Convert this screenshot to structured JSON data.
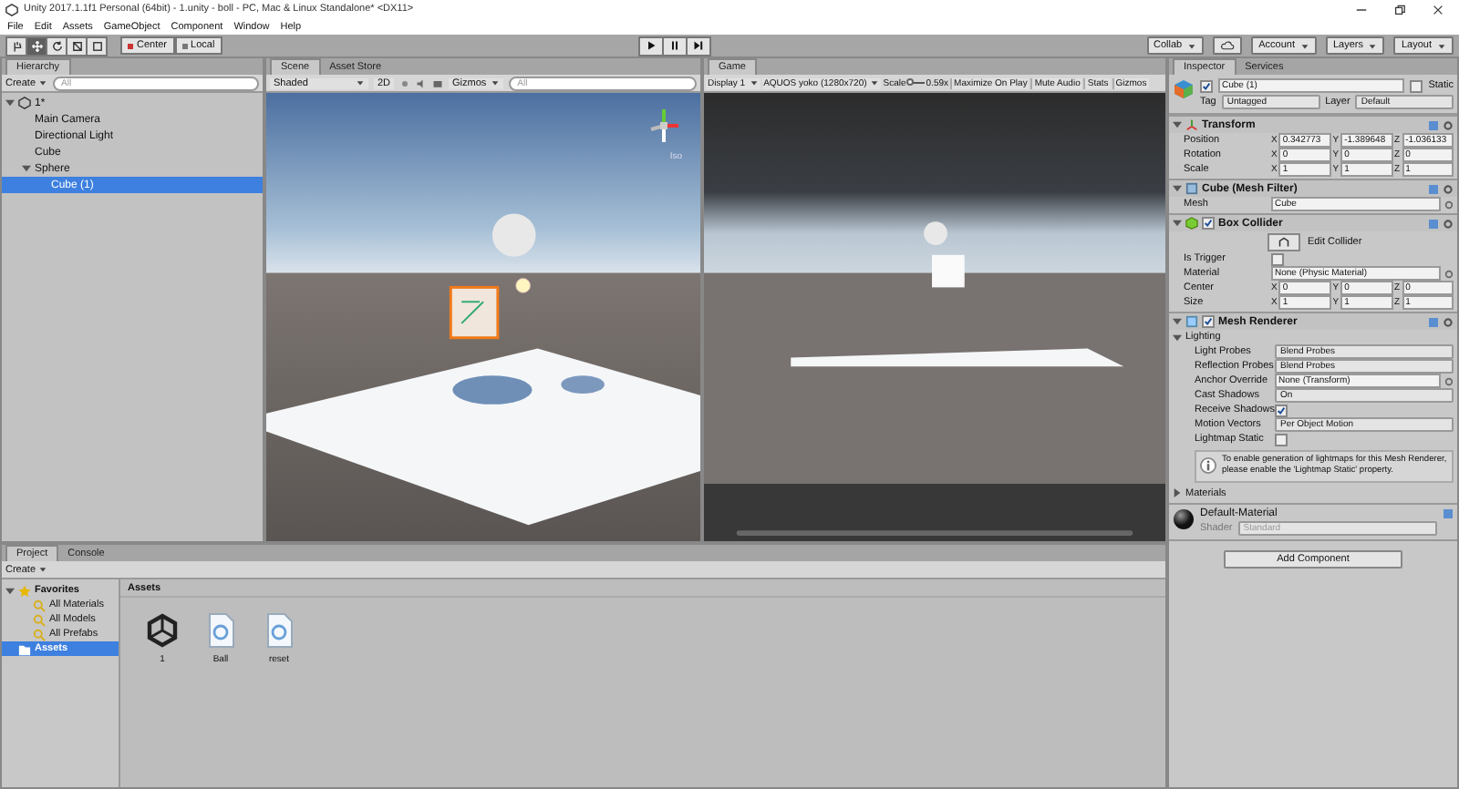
{
  "window": {
    "title": "Unity 2017.1.1f1 Personal (64bit) - 1.unity - boll - PC, Mac & Linux Standalone* <DX11>"
  },
  "menu": [
    "File",
    "Edit",
    "Assets",
    "GameObject",
    "Component",
    "Window",
    "Help"
  ],
  "toolbar": {
    "tools": [
      {
        "kind": "hand",
        "selected": false
      },
      {
        "kind": "move",
        "selected": true
      },
      {
        "kind": "rotate",
        "selected": false
      },
      {
        "kind": "scale",
        "selected": false
      },
      {
        "kind": "rect",
        "selected": false
      }
    ],
    "pivot": [
      "Center",
      "Local"
    ],
    "right": [
      {
        "kind": "dropdown",
        "label": "Collab"
      },
      {
        "kind": "cloud"
      },
      {
        "kind": "dropdown",
        "label": "Account"
      },
      {
        "kind": "dropdown",
        "label": "Layers"
      },
      {
        "kind": "dropdown",
        "label": "Layout"
      }
    ]
  },
  "hierarchy": {
    "tab": "Hierarchy",
    "create": "Create",
    "search_placeholder": "All",
    "tree": [
      {
        "label": "1*",
        "kind": "scene",
        "expanded": true,
        "selected": false,
        "children": [
          {
            "label": "Main Camera",
            "selected": false
          },
          {
            "label": "Directional Light",
            "selected": false
          },
          {
            "label": "Cube",
            "selected": false
          },
          {
            "label": "Sphere",
            "expanded": true,
            "selected": false,
            "children": [
              {
                "label": "Cube (1)",
                "selected": true
              }
            ]
          }
        ]
      }
    ]
  },
  "scene": {
    "tabs": [
      {
        "label": "Scene",
        "selected": true
      },
      {
        "label": "Asset Store",
        "selected": false
      }
    ],
    "shading": "Shaded",
    "mode_2d": "2D",
    "gizmos": "Gizmos",
    "search_placeholder": "All",
    "projection": "Iso"
  },
  "game": {
    "tab": "Game",
    "display": "Display 1",
    "resolution": "AQUOS yoko (1280x720)",
    "scale_label": "Scale",
    "scale_slider": {
      "level": 0.1
    },
    "scale": "0.59x",
    "buttons": [
      "Maximize On Play",
      "Mute Audio",
      "Stats",
      "Gizmos"
    ]
  },
  "inspector": {
    "tabs": [
      {
        "label": "Inspector",
        "selected": true
      },
      {
        "label": "Services",
        "selected": false
      }
    ],
    "object": {
      "name": "Cube (1)",
      "active": true,
      "static_label": "Static",
      "static": false,
      "tag_label": "Tag",
      "tag": "Untagged",
      "layer_label": "Layer",
      "layer": "Default"
    },
    "components": [
      {
        "kind": "transform",
        "title": "Transform",
        "rows": [
          {
            "kind": "vector3",
            "label": "Position",
            "values": [
              {
                "axis": "X",
                "value": "0.342773"
              },
              {
                "axis": "Y",
                "value": "-1.389648"
              },
              {
                "axis": "Z",
                "value": "-1.036133"
              }
            ]
          },
          {
            "kind": "vector3",
            "label": "Rotation",
            "values": [
              {
                "axis": "X",
                "value": "0"
              },
              {
                "axis": "Y",
                "value": "0"
              },
              {
                "axis": "Z",
                "value": "0"
              }
            ]
          },
          {
            "kind": "vector3",
            "label": "Scale",
            "values": [
              {
                "axis": "X",
                "value": "1"
              },
              {
                "axis": "Y",
                "value": "1"
              },
              {
                "axis": "Z",
                "value": "1"
              }
            ]
          }
        ]
      },
      {
        "kind": "mesh_filter",
        "title": "Cube (Mesh Filter)",
        "rows": [
          {
            "kind": "object",
            "label": "Mesh",
            "value": "Cube"
          }
        ]
      },
      {
        "kind": "box_collider",
        "title": "Box Collider",
        "enabled": true,
        "rows": [
          {
            "kind": "button",
            "label": "Edit Collider"
          },
          {
            "kind": "checkbox",
            "label": "Is Trigger",
            "checked": false
          },
          {
            "kind": "object",
            "label": "Material",
            "value": "None (Physic Material)"
          },
          {
            "kind": "vector3",
            "label": "Center",
            "values": [
              {
                "axis": "X",
                "value": "0"
              },
              {
                "axis": "Y",
                "value": "0"
              },
              {
                "axis": "Z",
                "value": "0"
              }
            ]
          },
          {
            "kind": "vector3",
            "label": "Size",
            "values": [
              {
                "axis": "X",
                "value": "1"
              },
              {
                "axis": "Y",
                "value": "1"
              },
              {
                "axis": "Z",
                "value": "1"
              }
            ]
          }
        ]
      },
      {
        "kind": "mesh_renderer",
        "title": "Mesh Renderer",
        "enabled": true,
        "rows": [
          {
            "kind": "foldout",
            "label": "Lighting",
            "expanded": true,
            "children": [
              {
                "kind": "dropdown",
                "label": "Light Probes",
                "value": "Blend Probes"
              },
              {
                "kind": "dropdown",
                "label": "Reflection Probes",
                "value": "Blend Probes"
              },
              {
                "kind": "object",
                "label": "Anchor Override",
                "value": "None (Transform)"
              },
              {
                "kind": "dropdown",
                "label": "Cast Shadows",
                "value": "On"
              },
              {
                "kind": "checkbox",
                "label": "Receive Shadows",
                "checked": true
              },
              {
                "kind": "dropdown",
                "label": "Motion Vectors",
                "value": "Per Object Motion"
              },
              {
                "kind": "checkbox",
                "label": "Lightmap Static",
                "checked": false
              },
              {
                "kind": "info",
                "text": "To enable generation of lightmaps for this Mesh Renderer, please enable the 'Lightmap Static' property."
              }
            ]
          },
          {
            "kind": "foldout",
            "label": "Materials",
            "expanded": false
          }
        ]
      },
      {
        "kind": "material",
        "title": "Default-Material",
        "shader_label": "Shader",
        "shader": "Standard"
      }
    ],
    "add_button": "Add Component"
  },
  "project": {
    "tabs": [
      {
        "label": "Project",
        "selected": true
      },
      {
        "label": "Console",
        "selected": false
      }
    ],
    "create": "Create",
    "tree": [
      {
        "label": "Favorites",
        "expanded": true,
        "selected": false,
        "children": [
          {
            "label": "All Materials",
            "selected": false
          },
          {
            "label": "All Models",
            "selected": false
          },
          {
            "label": "All Prefabs",
            "selected": false
          }
        ]
      },
      {
        "label": "Assets",
        "selected": true
      }
    ],
    "breadcrumb": "Assets",
    "assets": [
      {
        "kind": "scene",
        "label": "1"
      },
      {
        "kind": "script",
        "label": "Ball"
      },
      {
        "kind": "script",
        "label": "reset"
      }
    ]
  }
}
